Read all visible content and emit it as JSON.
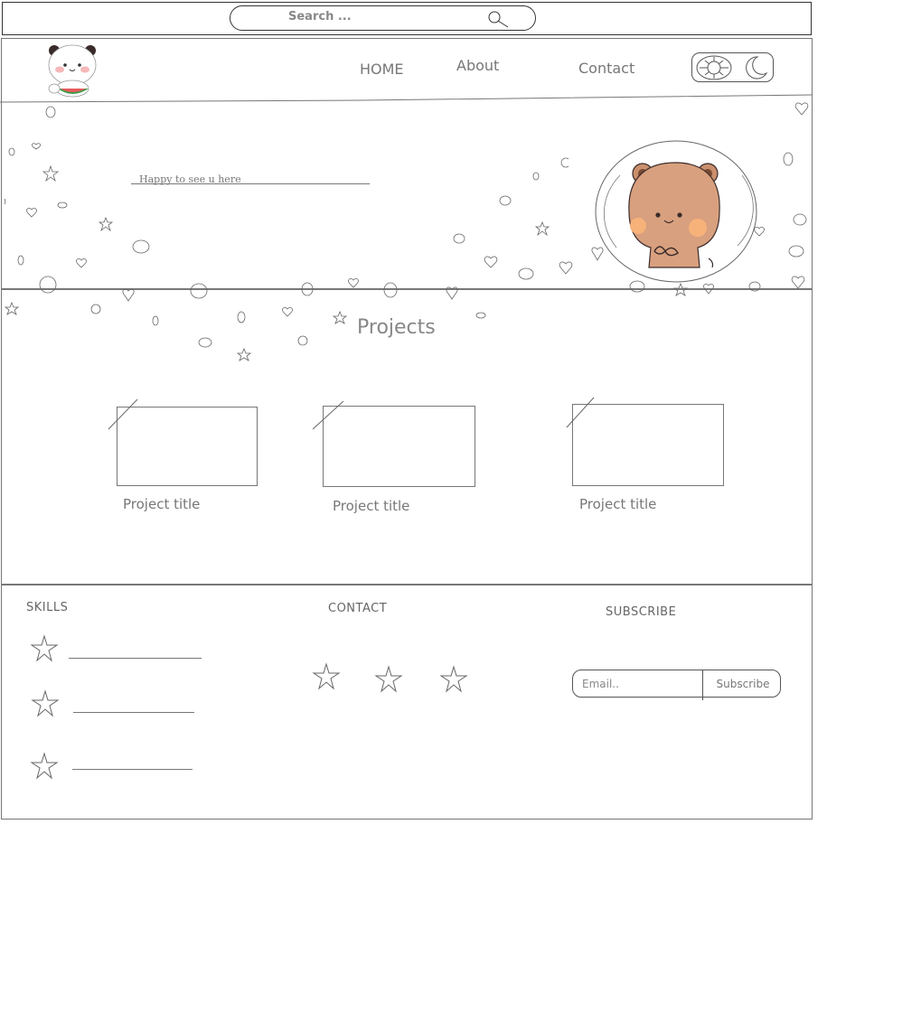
{
  "search": {
    "placeholder": "Search ..."
  },
  "nav": {
    "home_label": "HOME",
    "about_label": "About",
    "contact_label": "Contact"
  },
  "hero": {
    "tagline": "Happy to see u here"
  },
  "projects": {
    "title": "Projects",
    "items": [
      {
        "title": "Project title"
      },
      {
        "title": "Project title"
      },
      {
        "title": "Project title"
      }
    ]
  },
  "footer": {
    "skills_heading": "SKILLS",
    "contact_heading": "CONTACT",
    "subscribe_heading": "SUBSCRIBE",
    "email_placeholder": "Email..",
    "subscribe_label": "Subscribe"
  },
  "icons": {
    "search": "search-icon",
    "sun": "sun-icon",
    "moon": "moon-icon",
    "star": "star-icon"
  },
  "colors": {
    "bear": "#d8a07e",
    "panda_cheek": "#f7b8b8",
    "watermelon": "#3f9b4a",
    "outline": "#555555"
  }
}
